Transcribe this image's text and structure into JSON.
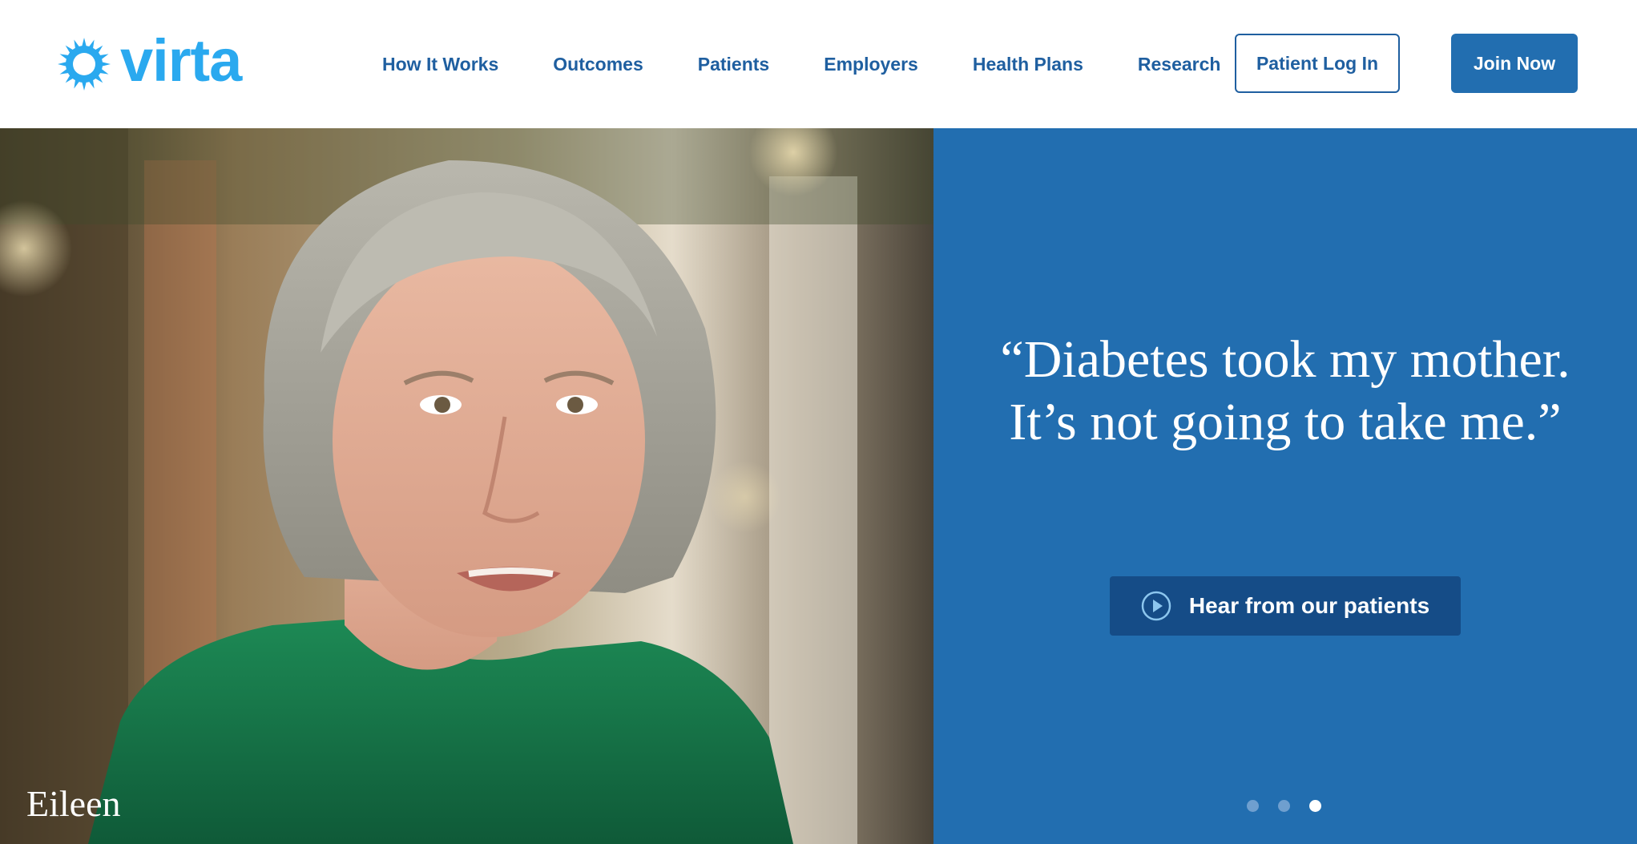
{
  "brand": {
    "name": "virta",
    "logo_icon": "sun-ring-icon",
    "primary_color": "#2aa9ef",
    "accent_color": "#226eb0"
  },
  "nav": {
    "items": [
      {
        "label": "How It Works"
      },
      {
        "label": "Outcomes"
      },
      {
        "label": "Patients"
      },
      {
        "label": "Employers"
      },
      {
        "label": "Health Plans"
      },
      {
        "label": "Research"
      }
    ],
    "login_label": "Patient Log In",
    "join_label": "Join Now"
  },
  "hero": {
    "person_name": "Eileen",
    "quote": "“Diabetes took my mother. It’s not going to take me.”",
    "cta_label": "Hear from our patients",
    "cta_icon": "play-circle-icon",
    "panel_color": "#226eb0",
    "carousel": {
      "slide_count": 3,
      "active_index": 2
    }
  }
}
